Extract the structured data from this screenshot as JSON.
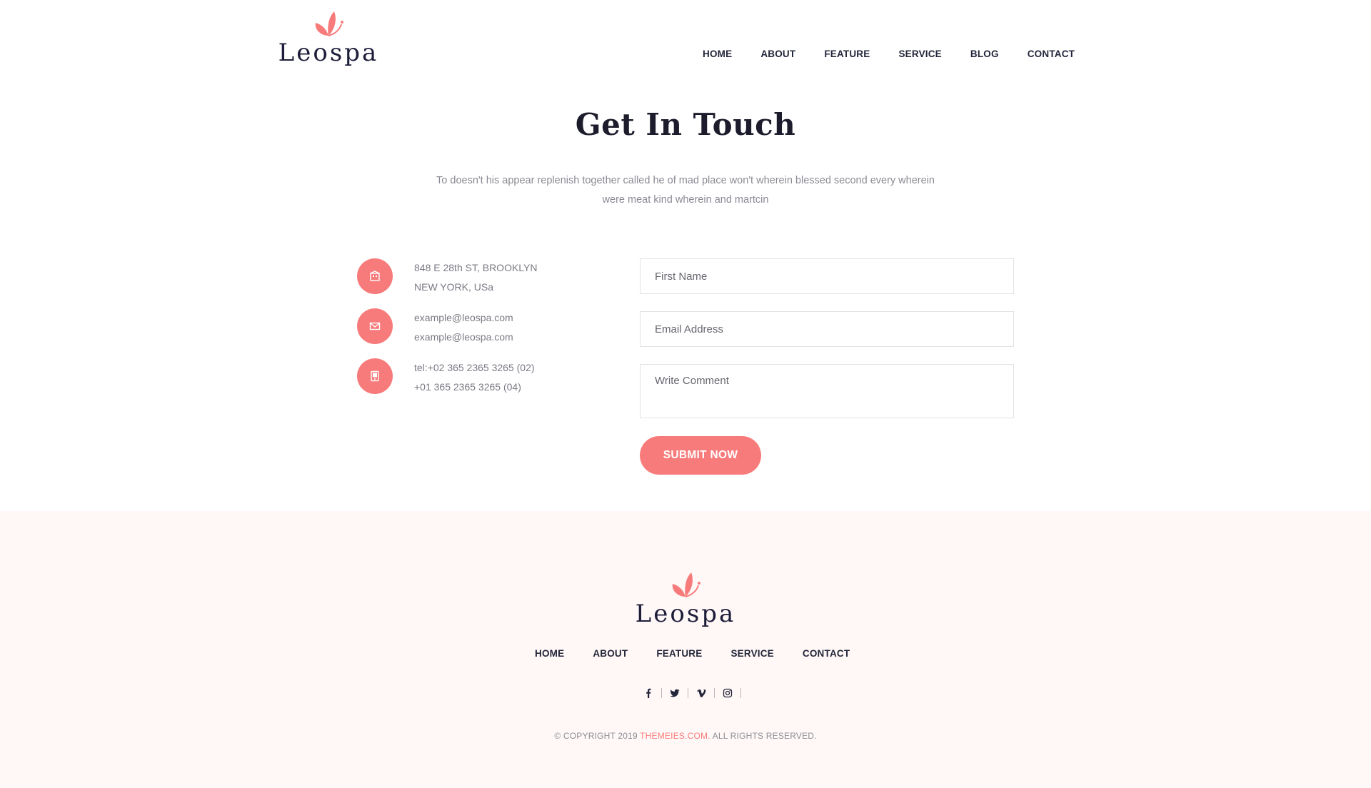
{
  "brand": {
    "name": "Leospa",
    "accent_color": "#f87b7b",
    "footer_bg": "#fff8f6"
  },
  "header": {
    "nav": [
      {
        "label": "HOME"
      },
      {
        "label": "ABOUT"
      },
      {
        "label": "FEATURE"
      },
      {
        "label": "SERVICE"
      },
      {
        "label": "BLOG"
      },
      {
        "label": "CONTACT"
      }
    ]
  },
  "contact": {
    "title": "Get In Touch",
    "description_line1": "To doesn't his appear replenish together called he of mad place won't wherein blessed second every wherein",
    "description_line2": "were meat kind wherein and martcin",
    "info": [
      {
        "icon": "building-icon",
        "line1": "848 E 28th ST, BROOKLYN",
        "line2": "NEW YORK, USa"
      },
      {
        "icon": "envelope-icon",
        "line1": "example@leospa.com",
        "line2": "example@leospa.com"
      },
      {
        "icon": "phone-icon",
        "line1": "tel:+02 365 2365 3265 (02)",
        "line2": "+01 365 2365 3265 (04)"
      }
    ],
    "form": {
      "first_name_placeholder": "First Name",
      "email_placeholder": "Email Address",
      "comment_placeholder": "Write Comment",
      "submit_label": "SUBMIT NOW"
    }
  },
  "footer": {
    "nav": [
      {
        "label": "HOME"
      },
      {
        "label": "ABOUT"
      },
      {
        "label": "FEATURE"
      },
      {
        "label": "SERVICE"
      },
      {
        "label": "CONTACT"
      }
    ],
    "social": [
      "facebook-icon",
      "twitter-icon",
      "vimeo-icon",
      "instagram-icon"
    ],
    "copyright_prefix": "© COPYRIGHT 2019 ",
    "copyright_link": "THEMEIES.COM.",
    "copyright_suffix": " ALL RIGHTS RESERVED."
  }
}
